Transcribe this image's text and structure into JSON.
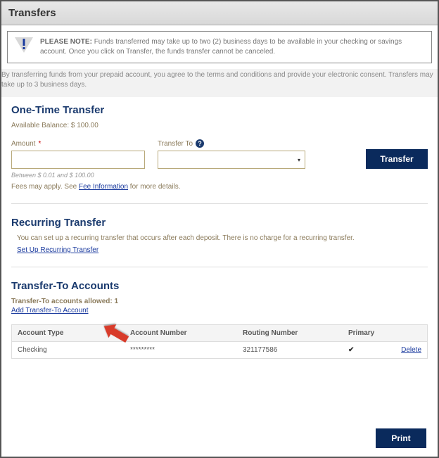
{
  "header": {
    "title": "Transfers"
  },
  "notice": {
    "label": "PLEASE NOTE:",
    "text": "Funds transferred may take up to two (2) business days to be available in your checking or savings account. Once you click on Transfer, the funds transfer cannot be canceled."
  },
  "consent": "By transferring funds from your prepaid account, you agree to the terms and conditions and provide your electronic consent. Transfers may take up to 3 business days.",
  "oneTime": {
    "heading": "One-Time Transfer",
    "available": "Available Balance: $ 100.00",
    "amountLabel": "Amount",
    "amountValue": "",
    "amountHelper": "Between $ 0.01 and $ 100.00",
    "transferToLabel": "Transfer To",
    "transferToValue": "",
    "transferBtn": "Transfer",
    "feesPrefix": "Fees may apply. See ",
    "feesLink": "Fee Information",
    "feesSuffix": " for more details."
  },
  "recurring": {
    "heading": "Recurring Transfer",
    "text": "You can set up a recurring transfer that occurs after each deposit. There is no charge for a recurring transfer.",
    "link": "Set Up Recurring Transfer"
  },
  "accounts": {
    "heading": "Transfer-To Accounts",
    "allowed": "Transfer-To accounts allowed: 1",
    "addLink": "Add Transfer-To Account",
    "cols": {
      "type": "Account Type",
      "acct": "Account Number",
      "route": "Routing Number",
      "primary": "Primary"
    },
    "rows": [
      {
        "type": "Checking",
        "acct": "*********",
        "route": "321177586",
        "primary": true,
        "action": "Delete"
      }
    ]
  },
  "footer": {
    "print": "Print"
  }
}
